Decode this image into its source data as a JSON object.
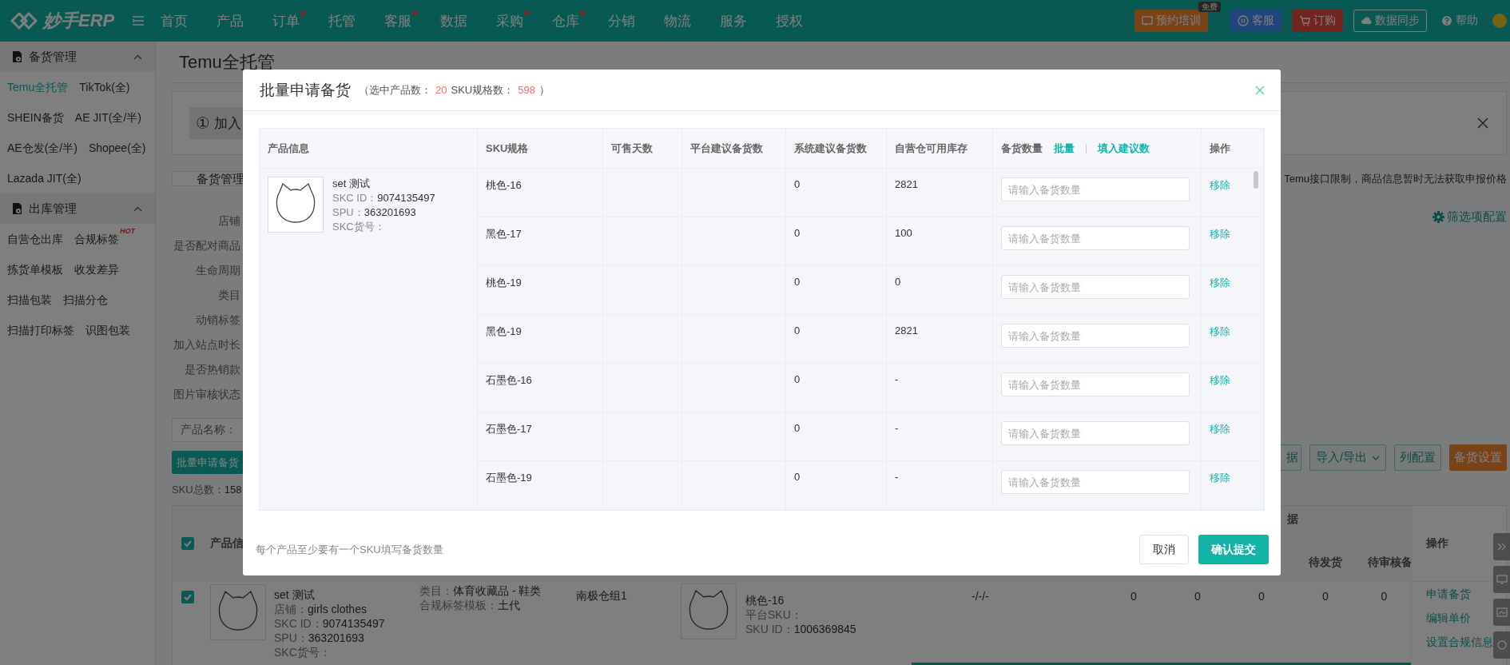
{
  "topbar": {
    "logo": "妙手ERP",
    "nav": [
      {
        "label": "首页",
        "dot": false
      },
      {
        "label": "产品",
        "dot": false
      },
      {
        "label": "订单",
        "dot": true
      },
      {
        "label": "托管",
        "dot": false
      },
      {
        "label": "客服",
        "dot": true
      },
      {
        "label": "数据",
        "dot": false
      },
      {
        "label": "采购",
        "dot": true
      },
      {
        "label": "仓库",
        "dot": true
      },
      {
        "label": "分销",
        "dot": false
      },
      {
        "label": "物流",
        "dot": false
      },
      {
        "label": "服务",
        "dot": false
      },
      {
        "label": "授权",
        "dot": false
      }
    ],
    "actions": [
      {
        "kind": "training",
        "label": "预约培训",
        "badge": "免费"
      },
      {
        "kind": "service",
        "label": "客服"
      },
      {
        "kind": "order",
        "label": "订购"
      },
      {
        "kind": "sync",
        "label": "数据同步"
      },
      {
        "kind": "help",
        "label": "帮助"
      }
    ]
  },
  "sidebar": {
    "groups": [
      {
        "title": "备货管理",
        "expanded": true,
        "items": [
          {
            "label": "Temu全托管",
            "selected": true
          },
          {
            "label": "TikTok(全)",
            "selected": false
          },
          {
            "label": "SHEIN备货",
            "selected": false
          },
          {
            "label": "AE JIT(全/半)",
            "selected": false
          },
          {
            "label": "AE仓发(全/半)",
            "selected": false
          },
          {
            "label": "Shopee(全)",
            "selected": false
          },
          {
            "label": "Lazada JIT(全)",
            "selected": false
          }
        ]
      },
      {
        "title": "出库管理",
        "expanded": true,
        "items": [
          {
            "label": "自营仓出库",
            "selected": false
          },
          {
            "label": "合规标签",
            "selected": false,
            "badge": "HOT"
          },
          {
            "label": "拣货单模板",
            "selected": false
          },
          {
            "label": "收发差异",
            "selected": false
          },
          {
            "label": "扫描包装",
            "selected": false
          },
          {
            "label": "扫描分仓",
            "selected": false
          },
          {
            "label": "扫描打印标签",
            "selected": false
          },
          {
            "label": "识图包装",
            "selected": false
          }
        ]
      }
    ]
  },
  "page": {
    "title": "Temu全托管",
    "step": {
      "number": "①",
      "text": "加入"
    },
    "tabs": [
      {
        "label": "备货管理",
        "selected": true
      }
    ],
    "notice": "Temu接口限制，商品信息暂时无法获取申报价格",
    "filters": [
      "店铺",
      "是否配对商品",
      "生命周期",
      "类目",
      "动销标签",
      "加入站点时长",
      "是否热销款",
      "图片审核状态"
    ],
    "filter_config": "筛选项配置",
    "search": {
      "label": "产品名称："
    },
    "batch_button": "批量申请备货",
    "sku_total": {
      "label": "SKU总数：",
      "value": "158"
    },
    "toolbar": [
      {
        "kind": "outline",
        "label": "据"
      },
      {
        "kind": "dropdown",
        "label": "导入/导出"
      },
      {
        "kind": "outline",
        "label": "列配置"
      },
      {
        "kind": "warning",
        "label": "备货设置"
      }
    ],
    "table": {
      "all_checked": true,
      "columns": {
        "product": "产品信",
        "group": "据",
        "pending_ship": "待发货",
        "pending_review": "待审核备",
        "actions": "操作"
      },
      "rows": [
        {
          "checked": true,
          "name": "set 测试",
          "info": [
            {
              "label": "店铺：",
              "value": "girls clothes"
            },
            {
              "label": "SKC ID：",
              "value": "9074135497"
            },
            {
              "label": "SPU：",
              "value": "363201693"
            },
            {
              "label": "SKC货号："
            }
          ],
          "category": [
            {
              "label": "类目：",
              "value": "体育收藏品 - 鞋类"
            },
            {
              "label": "合规标签模板：",
              "value": "土代"
            }
          ],
          "warehouse": "南极仓组1",
          "sku": {
            "name": "桃色-16",
            "info": [
              {
                "label": "平台SKU："
              },
              {
                "label": "SKU ID：",
                "value": "1006369845"
              }
            ]
          },
          "ratio": "-/-/-",
          "values": [
            "0",
            "0",
            "0",
            "0",
            "0"
          ],
          "actions": [
            "申请备货",
            "编辑单价",
            "设置合规信息"
          ]
        }
      ]
    }
  },
  "modal": {
    "title": "批量申请备货",
    "summary": [
      {
        "kind": "text",
        "text": "（选中产品数："
      },
      {
        "kind": "count",
        "text": "20"
      },
      {
        "kind": "text",
        "text": "SKU规格数："
      },
      {
        "kind": "count",
        "text": "598"
      },
      {
        "kind": "text",
        "text": "）"
      }
    ],
    "columns": [
      "产品信息",
      "SKU规格",
      "可售天数",
      "平台建议备货数",
      "系统建议备货数",
      "自营仓可用库存",
      "备货数量",
      "操作"
    ],
    "qty_links": [
      "批量",
      "填入建议数"
    ],
    "product": {
      "name": "set 测试",
      "info": [
        {
          "label": "SKC ID：",
          "value": "9074135497"
        },
        {
          "label": "SPU：",
          "value": "363201693"
        },
        {
          "label": "SKC货号："
        }
      ]
    },
    "rows": [
      {
        "sku": "桃色-16",
        "system": "0",
        "stock": "2821",
        "placeholder": "请输入备货数量",
        "action": "移除"
      },
      {
        "sku": "黑色-17",
        "system": "0",
        "stock": "100",
        "placeholder": "请输入备货数量",
        "action": "移除"
      },
      {
        "sku": "桃色-19",
        "system": "0",
        "stock": "0",
        "placeholder": "请输入备货数量",
        "action": "移除"
      },
      {
        "sku": "黑色-19",
        "system": "0",
        "stock": "2821",
        "placeholder": "请输入备货数量",
        "action": "移除"
      },
      {
        "sku": "石墨色-16",
        "system": "0",
        "stock": "-",
        "placeholder": "请输入备货数量",
        "action": "移除"
      },
      {
        "sku": "石墨色-17",
        "system": "0",
        "stock": "-",
        "placeholder": "请输入备货数量",
        "action": "移除"
      },
      {
        "sku": "石墨色-19",
        "system": "0",
        "stock": "-",
        "placeholder": "请输入备货数量",
        "action": "移除"
      }
    ],
    "note": "每个产品至少要有一个SKU填写备货数量",
    "buttons": [
      {
        "kind": "default",
        "label": "取消"
      },
      {
        "kind": "primary",
        "label": "确认提交"
      }
    ]
  }
}
